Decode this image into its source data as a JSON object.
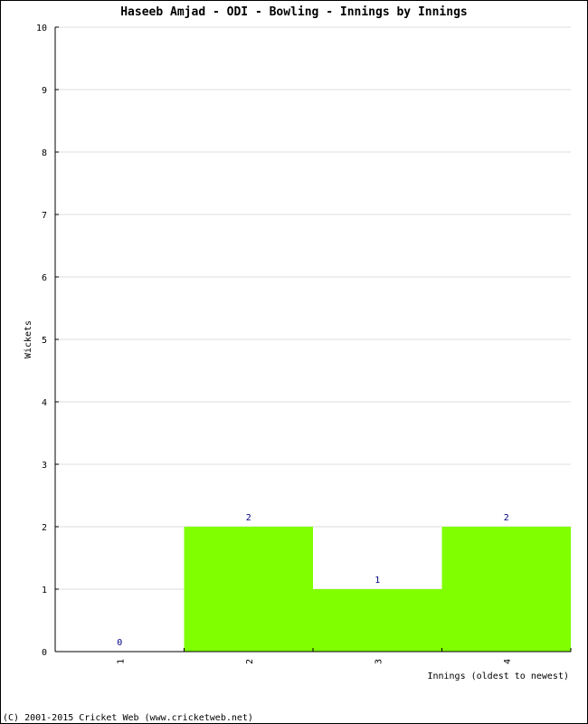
{
  "chart_data": {
    "type": "bar",
    "title": "Haseeb Amjad - ODI - Bowling - Innings by Innings",
    "xlabel": "Innings (oldest to newest)",
    "ylabel": "Wickets",
    "categories": [
      "1",
      "2",
      "3",
      "4"
    ],
    "values": [
      0,
      2,
      1,
      2
    ],
    "ylim": [
      0,
      10
    ],
    "yticks": [
      0,
      1,
      2,
      3,
      4,
      5,
      6,
      7,
      8,
      9,
      10
    ],
    "grid": true,
    "bar_color": "#80ff00",
    "label_color": "#000080",
    "grid_color": "#dddddd"
  },
  "footer": "(C) 2001-2015 Cricket Web (www.cricketweb.net)"
}
